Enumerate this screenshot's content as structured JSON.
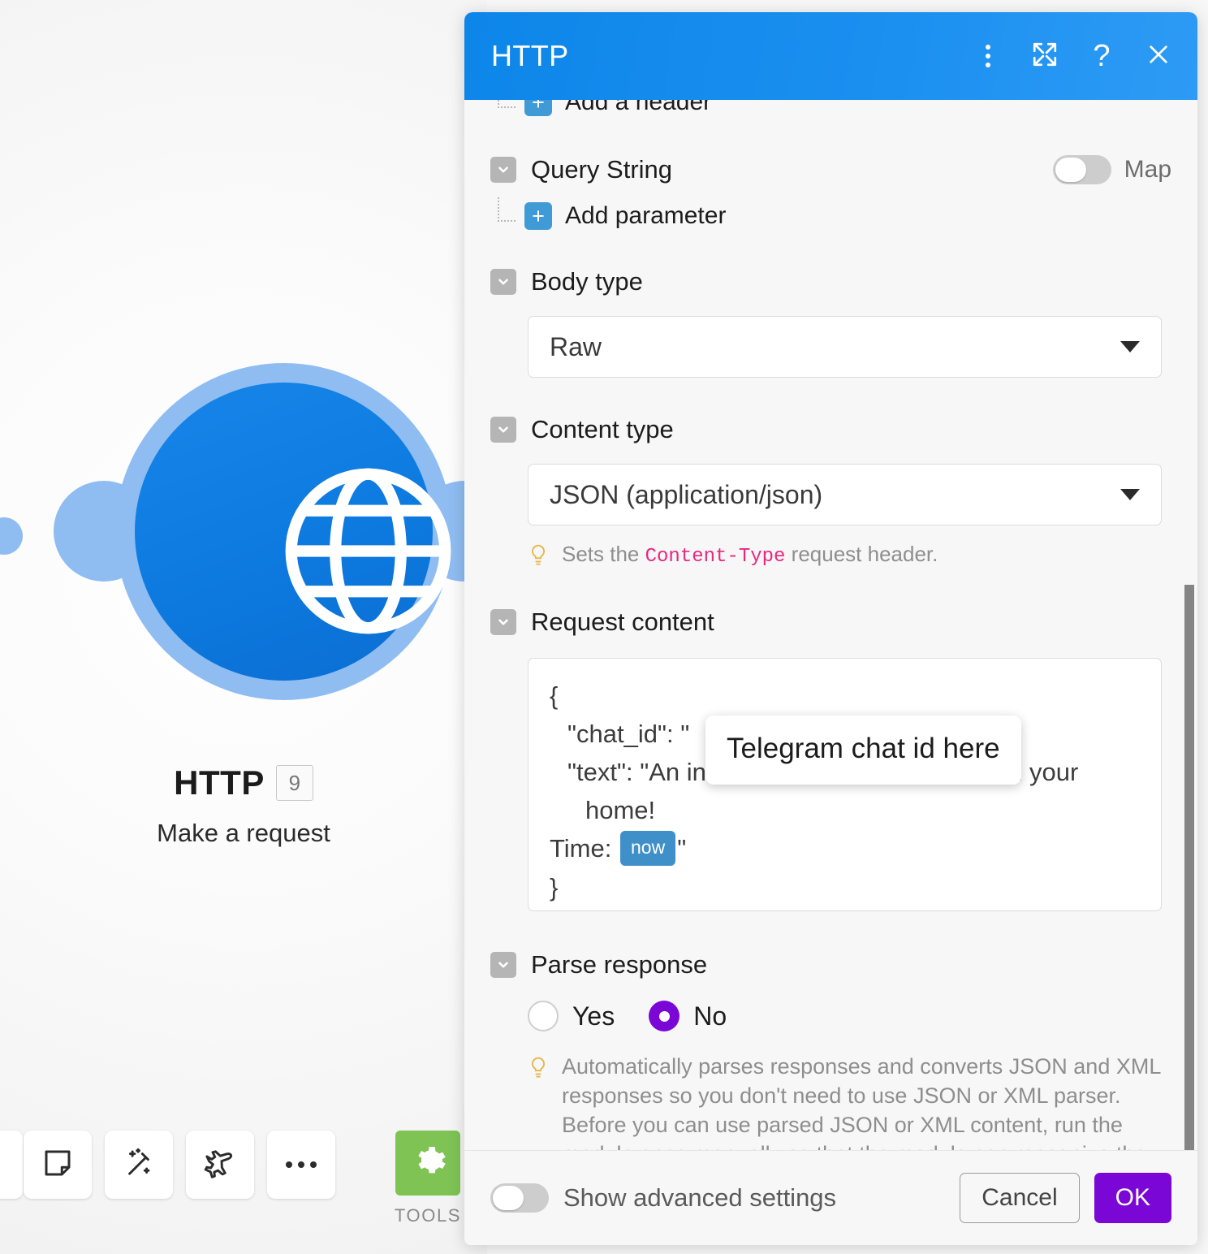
{
  "canvas": {
    "node": {
      "title": "HTTP",
      "badge": "9",
      "subtitle": "Make a request",
      "icon": "globe-icon"
    },
    "toolbar": {
      "note_icon": "sticky-note-icon",
      "wand_icon": "magic-wand-icon",
      "plane_icon": "airplane-icon",
      "more_icon": "ellipsis-icon",
      "tools_icon": "gear-icon",
      "tools_label": "TOOLS"
    }
  },
  "panel": {
    "title": "HTTP",
    "header_icons": {
      "menu": "vertical-dots-icon",
      "expand": "expand-arrows-icon",
      "help": "question-mark-icon",
      "close": "close-x-icon"
    },
    "sections": {
      "headers": {
        "add_label": "Add a header"
      },
      "query_string": {
        "label": "Query String",
        "add_label": "Add parameter",
        "map_label": "Map",
        "map_on": false
      },
      "body_type": {
        "label": "Body type",
        "value": "Raw"
      },
      "content_type": {
        "label": "Content type",
        "value": "JSON (application/json)",
        "hint_before": "Sets the ",
        "hint_code": "Content-Type",
        "hint_after": " request header."
      },
      "request_content": {
        "label": "Request content",
        "line_open": "{",
        "line_chat_id": "\"chat_id\": \"",
        "line_text": "\"text\": \"An intrusion has been detected in your home!",
        "line_time_prefix": "Time:",
        "time_token": "now",
        "line_time_suffix": "\"",
        "line_close": "}",
        "tooltip": "Telegram chat id here"
      },
      "parse_response": {
        "label": "Parse response",
        "option_yes": "Yes",
        "option_no": "No",
        "selected": "No",
        "hint": "Automatically parses responses and converts JSON and XML responses so you don't need to use JSON or XML parser. Before you can use parsed JSON or XML content, run the module once manually so that the module can recognize the response content and allows you to map it in subsequent modules."
      }
    },
    "footer": {
      "advanced_label": "Show advanced settings",
      "advanced_on": false,
      "cancel_label": "Cancel",
      "ok_label": "OK"
    }
  },
  "colors": {
    "header_blue": "#1a8ff0",
    "accent_purple": "#7b07d6",
    "node_blue": "#0d7ae0",
    "node_halo": "#8fbdf2",
    "tools_green": "#7ec354",
    "pink_code": "#e8287f",
    "token_blue": "#3f8fc9"
  }
}
